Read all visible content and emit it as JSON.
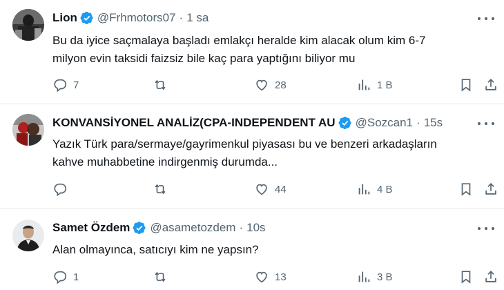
{
  "tweets": [
    {
      "name": "Lion",
      "handle": "@Frhmotors07",
      "separator": "·",
      "time": "1 sa",
      "text_lines": [
        "Bu da iyice saçmalaya başladı emlakçı heralde kim alacak olum kim 6-7",
        "milyon evin taksidi faizsiz bile kaç para yaptığını biliyor mu"
      ],
      "replies": "7",
      "retweets": "",
      "likes": "28",
      "views": "1 B"
    },
    {
      "name": "KONVANSİYONEL ANALİZ(CPA-INDEPENDENT AU",
      "handle": "@Sozcan1",
      "separator": "·",
      "time": "15s",
      "text_lines": [
        "Yazık Türk para/sermaye/gayrimenkul piyasası bu ve benzeri arkadaşların",
        "kahve muhabbetine indirgenmiş durumda..."
      ],
      "replies": "",
      "retweets": "",
      "likes": "44",
      "views": "4 B"
    },
    {
      "name": "Samet Özdem",
      "handle": "@asametozdem",
      "separator": "·",
      "time": "10s",
      "text_lines": [
        "Alan olmayınca, satıcıyı kim ne yapsın?"
      ],
      "replies": "1",
      "retweets": "",
      "likes": "13",
      "views": "3 B"
    }
  ],
  "icons": {
    "reply": "reply-icon",
    "retweet": "retweet-icon",
    "like": "heart-icon",
    "views": "views-icon",
    "bookmark": "bookmark-icon",
    "share": "share-icon",
    "verified": "verified-badge-icon",
    "more": "more-options-icon"
  },
  "colors": {
    "text": "#0f1419",
    "secondary": "#536471",
    "verified": "#1d9bf0",
    "divider": "#e3e7eb"
  }
}
